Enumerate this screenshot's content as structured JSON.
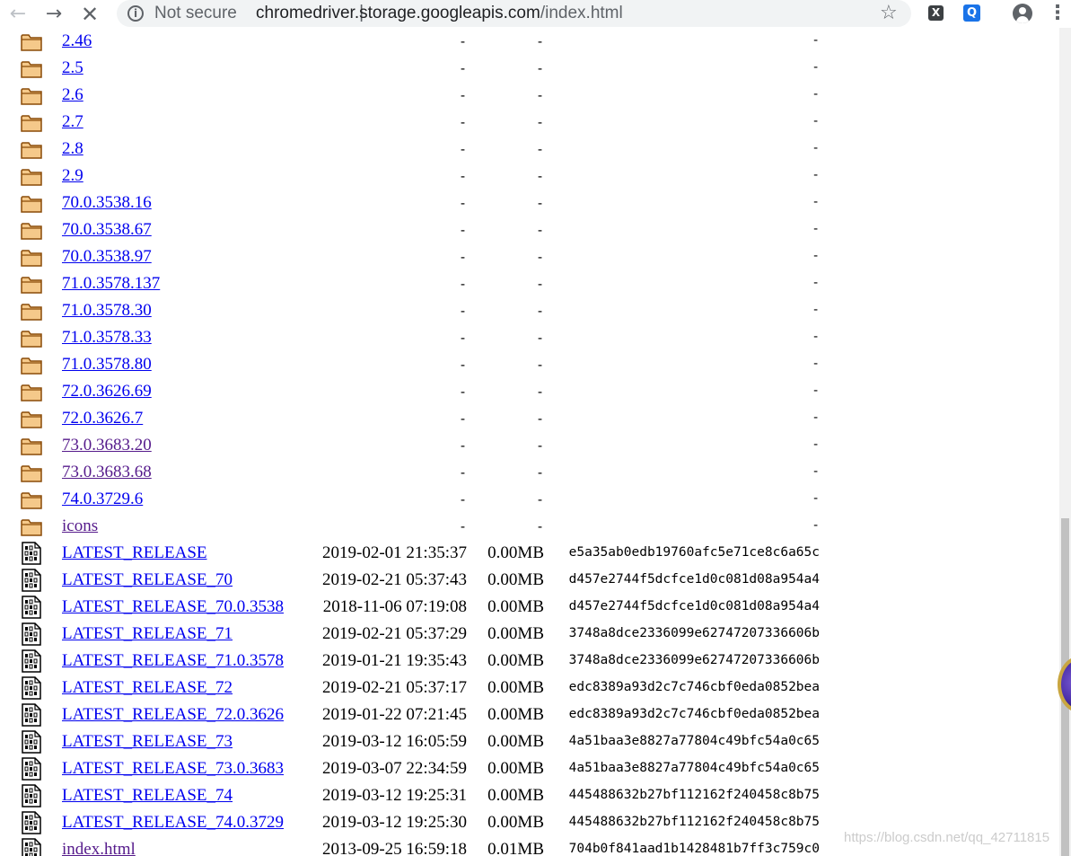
{
  "browser": {
    "security_label": "Not secure",
    "separator": "|",
    "url_host": "chromedriver.storage.googleapis.com",
    "url_path": "/index.html",
    "extensions": {
      "x_label": "X",
      "q_label": "Q"
    }
  },
  "listing": [
    {
      "icon": "folder",
      "name": "2.46",
      "date": "",
      "size": "-",
      "hash": "-",
      "visited": false
    },
    {
      "icon": "folder",
      "name": "2.5",
      "date": "",
      "size": "-",
      "hash": "-",
      "visited": false
    },
    {
      "icon": "folder",
      "name": "2.6",
      "date": "",
      "size": "-",
      "hash": "-",
      "visited": false
    },
    {
      "icon": "folder",
      "name": "2.7",
      "date": "",
      "size": "-",
      "hash": "-",
      "visited": false
    },
    {
      "icon": "folder",
      "name": "2.8",
      "date": "",
      "size": "-",
      "hash": "-",
      "visited": false
    },
    {
      "icon": "folder",
      "name": "2.9",
      "date": "",
      "size": "-",
      "hash": "-",
      "visited": false
    },
    {
      "icon": "folder",
      "name": "70.0.3538.16",
      "date": "",
      "size": "-",
      "hash": "-",
      "visited": false
    },
    {
      "icon": "folder",
      "name": "70.0.3538.67",
      "date": "",
      "size": "-",
      "hash": "-",
      "visited": false
    },
    {
      "icon": "folder",
      "name": "70.0.3538.97",
      "date": "",
      "size": "-",
      "hash": "-",
      "visited": false
    },
    {
      "icon": "folder",
      "name": "71.0.3578.137",
      "date": "",
      "size": "-",
      "hash": "-",
      "visited": false
    },
    {
      "icon": "folder",
      "name": "71.0.3578.30",
      "date": "",
      "size": "-",
      "hash": "-",
      "visited": false
    },
    {
      "icon": "folder",
      "name": "71.0.3578.33",
      "date": "",
      "size": "-",
      "hash": "-",
      "visited": false
    },
    {
      "icon": "folder",
      "name": "71.0.3578.80",
      "date": "",
      "size": "-",
      "hash": "-",
      "visited": false
    },
    {
      "icon": "folder",
      "name": "72.0.3626.69",
      "date": "",
      "size": "-",
      "hash": "-",
      "visited": false
    },
    {
      "icon": "folder",
      "name": "72.0.3626.7",
      "date": "",
      "size": "-",
      "hash": "-",
      "visited": false
    },
    {
      "icon": "folder",
      "name": "73.0.3683.20",
      "date": "",
      "size": "-",
      "hash": "-",
      "visited": true
    },
    {
      "icon": "folder",
      "name": "73.0.3683.68",
      "date": "",
      "size": "-",
      "hash": "-",
      "visited": true
    },
    {
      "icon": "folder",
      "name": "74.0.3729.6",
      "date": "",
      "size": "-",
      "hash": "-",
      "visited": false
    },
    {
      "icon": "folder",
      "name": "icons",
      "date": "",
      "size": "-",
      "hash": "-",
      "visited": true
    },
    {
      "icon": "file",
      "name": "LATEST_RELEASE",
      "date": "2019-02-01 21:35:37",
      "size": "0.00MB",
      "hash": "e5a35ab0edb19760afc5e71ce8c6a65c",
      "visited": false
    },
    {
      "icon": "file",
      "name": "LATEST_RELEASE_70",
      "date": "2019-02-21 05:37:43",
      "size": "0.00MB",
      "hash": "d457e2744f5dcfce1d0c081d08a954a4",
      "visited": false
    },
    {
      "icon": "file",
      "name": "LATEST_RELEASE_70.0.3538",
      "date": "2018-11-06 07:19:08",
      "size": "0.00MB",
      "hash": "d457e2744f5dcfce1d0c081d08a954a4",
      "visited": false
    },
    {
      "icon": "file",
      "name": "LATEST_RELEASE_71",
      "date": "2019-02-21 05:37:29",
      "size": "0.00MB",
      "hash": "3748a8dce2336099e62747207336606b",
      "visited": false
    },
    {
      "icon": "file",
      "name": "LATEST_RELEASE_71.0.3578",
      "date": "2019-01-21 19:35:43",
      "size": "0.00MB",
      "hash": "3748a8dce2336099e62747207336606b",
      "visited": false
    },
    {
      "icon": "file",
      "name": "LATEST_RELEASE_72",
      "date": "2019-02-21 05:37:17",
      "size": "0.00MB",
      "hash": "edc8389a93d2c7c746cbf0eda0852bea",
      "visited": false
    },
    {
      "icon": "file",
      "name": "LATEST_RELEASE_72.0.3626",
      "date": "2019-01-22 07:21:45",
      "size": "0.00MB",
      "hash": "edc8389a93d2c7c746cbf0eda0852bea",
      "visited": false
    },
    {
      "icon": "file",
      "name": "LATEST_RELEASE_73",
      "date": "2019-03-12 16:05:59",
      "size": "0.00MB",
      "hash": "4a51baa3e8827a77804c49bfc54a0c65",
      "visited": false
    },
    {
      "icon": "file",
      "name": "LATEST_RELEASE_73.0.3683",
      "date": "2019-03-07 22:34:59",
      "size": "0.00MB",
      "hash": "4a51baa3e8827a77804c49bfc54a0c65",
      "visited": false
    },
    {
      "icon": "file",
      "name": "LATEST_RELEASE_74",
      "date": "2019-03-12 19:25:31",
      "size": "0.00MB",
      "hash": "445488632b27bf112162f240458c8b75",
      "visited": false
    },
    {
      "icon": "file",
      "name": "LATEST_RELEASE_74.0.3729",
      "date": "2019-03-12 19:25:30",
      "size": "0.00MB",
      "hash": "445488632b27bf112162f240458c8b75",
      "visited": false
    },
    {
      "icon": "file",
      "name": "index.html",
      "date": "2013-09-25 16:59:18",
      "size": "0.01MB",
      "hash": "704b0f841aad1b1428481b7ff3c759c0",
      "visited": true
    }
  ],
  "watermark": "https://blog.csdn.net/qq_42711815",
  "colors": {
    "link": "#0000ee",
    "visited_link": "#551a8b",
    "folder_fill": "#f5c98a",
    "folder_stroke": "#8a4b08"
  }
}
